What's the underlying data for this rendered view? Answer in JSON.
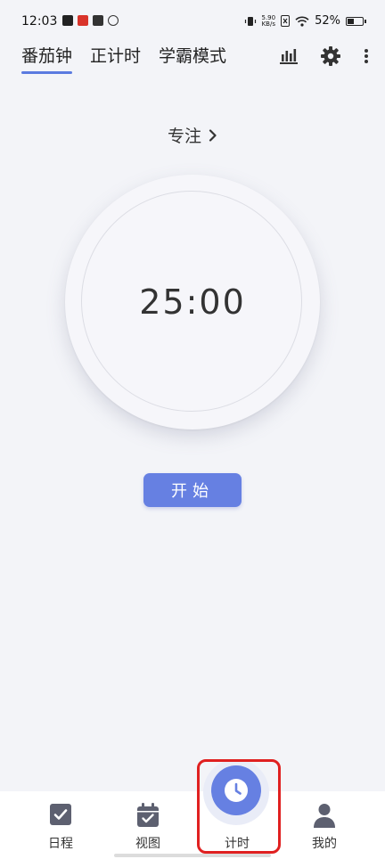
{
  "status_bar": {
    "time": "12:03",
    "speed_value": "5.90",
    "speed_unit": "KB/s",
    "battery": "52%",
    "battery_level": 0.52
  },
  "tabs": [
    {
      "label": "番茄钟",
      "active": true
    },
    {
      "label": "正计时",
      "active": false
    },
    {
      "label": "学霸模式",
      "active": false
    }
  ],
  "top_icons": [
    "stats-icon",
    "settings-icon",
    "more-icon"
  ],
  "focus_label": "专注",
  "timer": {
    "display": "25:00"
  },
  "start_button": "开始",
  "bottom_nav": [
    {
      "label": "日程",
      "icon": "check-square-icon"
    },
    {
      "label": "视图",
      "icon": "calendar-icon"
    },
    {
      "label": "计时",
      "icon": "clock-icon",
      "active": true
    },
    {
      "label": "我的",
      "icon": "person-icon"
    }
  ],
  "colors": {
    "accent": "#6680e2",
    "background": "#f3f4f8",
    "highlight": "#e02020"
  }
}
